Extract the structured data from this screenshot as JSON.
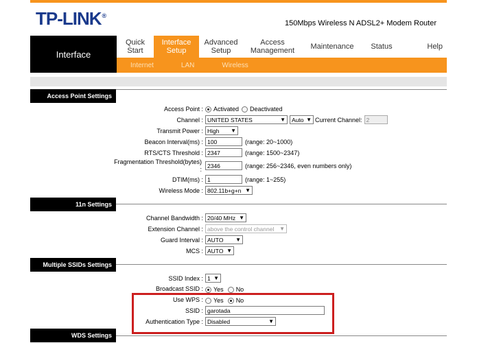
{
  "brand": {
    "logo": "TP-LINK",
    "model": "150Mbps Wireless N ADSL2+ Modem Router"
  },
  "nav": {
    "section": "Interface",
    "items": [
      {
        "label": "Quick Start",
        "active": false
      },
      {
        "label": "Interface Setup",
        "active": true
      },
      {
        "label": "Advanced Setup",
        "active": false
      },
      {
        "label": "Access Management",
        "active": false
      },
      {
        "label": "Maintenance",
        "active": false
      },
      {
        "label": "Status",
        "active": false
      },
      {
        "label": "Help",
        "active": false
      }
    ],
    "subitems": [
      "Internet",
      "LAN",
      "Wireless"
    ]
  },
  "ap": {
    "header": "Access Point Settings",
    "access_point_label": "Access Point :",
    "activated": "Activated",
    "deactivated": "Deactivated",
    "channel_label": "Channel :",
    "channel_country": "UNITED STATES",
    "channel_mode": "Auto",
    "current_channel_label": "Current Channel:",
    "current_channel": "2",
    "tx_power_label": "Transmit Power :",
    "tx_power": "High",
    "beacon_label": "Beacon Interval(ms) :",
    "beacon": "100",
    "beacon_range": "(range: 20~1000)",
    "rts_label": "RTS/CTS Threshold :",
    "rts": "2347",
    "rts_range": "(range: 1500~2347)",
    "frag_label": "Fragmentation Threshold(bytes) :",
    "frag": "2346",
    "frag_range": "(range: 256~2346, even numbers only)",
    "dtim_label": "DTIM(ms) :",
    "dtim": "1",
    "dtim_range": "(range: 1~255)",
    "mode_label": "Wireless Mode :",
    "mode": "802.11b+g+n"
  },
  "n11": {
    "header": "11n Settings",
    "bandwidth_label": "Channel Bandwidth :",
    "bandwidth": "20/40 MHz",
    "ext_label": "Extension Channel :",
    "ext": "above the control channel",
    "guard_label": "Guard Interval :",
    "guard": "AUTO",
    "mcs_label": "MCS :",
    "mcs": "AUTO"
  },
  "ssids": {
    "header": "Multiple SSIDs Settings",
    "index_label": "SSID Index :",
    "index": "1",
    "broadcast_label": "Broadcast SSID :",
    "yes": "Yes",
    "no": "No",
    "wps_label": "Use WPS :",
    "ssid_label": "SSID :",
    "ssid": "garotada",
    "auth_label": "Authentication Type :",
    "auth": "Disabled"
  },
  "wds": {
    "header": "WDS Settings"
  }
}
